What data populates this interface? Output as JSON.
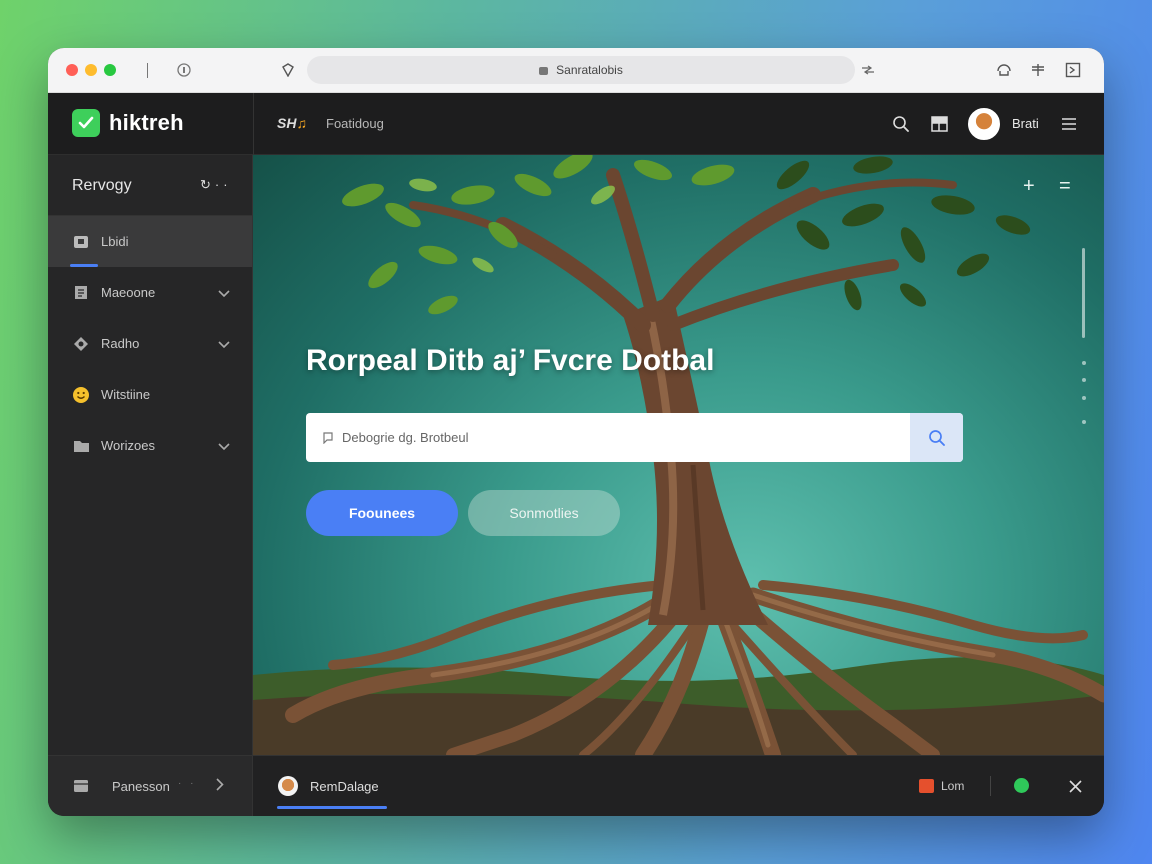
{
  "browser": {
    "url": "Sanratalobis"
  },
  "appbar": {
    "brand": "hiktreh",
    "crumb_logo": "SH",
    "crumb_text": "Foatidoug",
    "user_name": "Brati"
  },
  "sidebar": {
    "header": "Rervogy",
    "items": [
      {
        "label": "Lbidi",
        "icon": "square-icon"
      },
      {
        "label": "Maeoone",
        "icon": "document-icon"
      },
      {
        "label": "Radho",
        "icon": "puzzle-icon"
      },
      {
        "label": "Witstiine",
        "icon": "smiley-icon"
      },
      {
        "label": "Worizoes",
        "icon": "folder-icon"
      }
    ],
    "footer": "Panesson"
  },
  "hero": {
    "title": "Rorpeal Ditb aj’ Fvcre Dotbal",
    "search_placeholder": "Debogrie dg. Brotbeul",
    "primary_button": "Foounees",
    "secondary_button": "Sonmotlies"
  },
  "bottombar": {
    "label": "RemDalage",
    "status": "Lom"
  },
  "colors": {
    "accent": "#4a7ff5",
    "brand_green": "#3ecf5b",
    "status_orange": "#e5502d",
    "status_green": "#2fc95a"
  }
}
